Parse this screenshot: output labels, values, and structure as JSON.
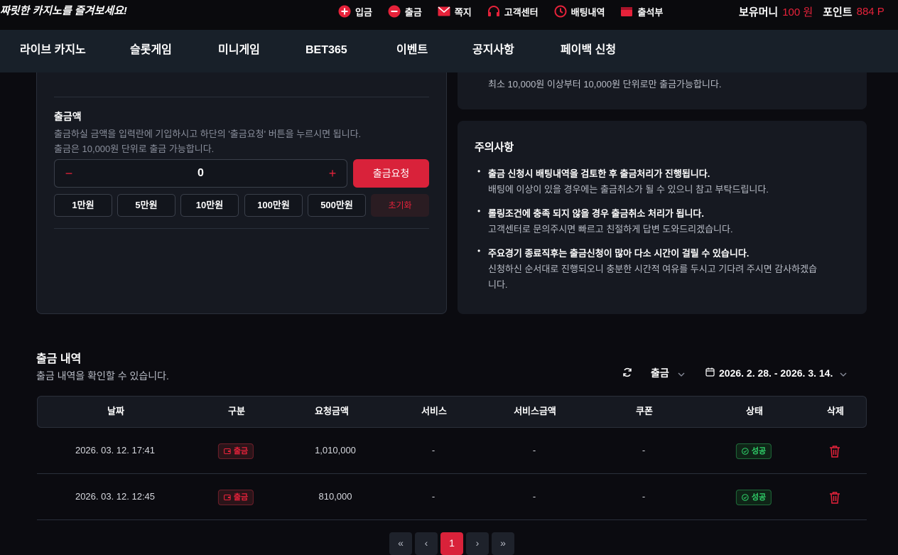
{
  "header": {
    "slogan": "짜릿한 카지노를 즐겨보세요!",
    "links": [
      {
        "label": "입금",
        "icon": "plus-circle-icon"
      },
      {
        "label": "출금",
        "icon": "minus-circle-icon"
      },
      {
        "label": "쪽지",
        "icon": "envelope-icon"
      },
      {
        "label": "고객센터",
        "icon": "headset-icon"
      },
      {
        "label": "배팅내역",
        "icon": "history-clock-icon"
      },
      {
        "label": "출석부",
        "icon": "calendar-icon"
      }
    ],
    "money_label": "보유머니",
    "money_value": "100 원",
    "point_label": "포인트",
    "point_value": "884 P"
  },
  "nav": [
    "라이브 카지노",
    "슬롯게임",
    "미니게임",
    "BET365",
    "이벤트",
    "공지사항",
    "페이백 신청"
  ],
  "withdraw": {
    "label": "출금액",
    "desc1": "출금하실 금액을 입력란에 기입하시고 하단의 '출금요청' 버튼을 누르시면 됩니다.",
    "desc2": "출금은 10,000원 단위로 출금 가능합니다.",
    "amount": "0",
    "minus": "−",
    "plus": "+",
    "submit": "출금요청",
    "quick": [
      "1만원",
      "5만원",
      "10만원",
      "100만원",
      "500만원"
    ],
    "reset": "초기화"
  },
  "info_top": "최소 10,000원 이상부터 10,000원 단위로만 출금가능합니다.",
  "notice": {
    "title": "주의사항",
    "bullet": "•",
    "items": [
      {
        "head": "출금 신청시 배팅내역을 검토한 후 출금처리가 진행됩니다.",
        "sub": "배팅에 이상이 있을 경우에는 출금취소가 될 수 있으니 참고 부탁드립니다."
      },
      {
        "head": "롤링조건에 충족 되지 않을 경우 출금취소 처리가 됩니다.",
        "sub": "고객센터로 문의주시면 빠르고 친절하게 답변 도와드리겠습니다."
      },
      {
        "head": "주요경기 종료직후는 출금신청이 많아 다소 시간이 걸릴 수 있습니다.",
        "sub": "신청하신 순서대로 진행되오니 충분한 시간적 여유를 두시고 기다려 주시면 감사하겠습",
        "sub2": "니다."
      }
    ]
  },
  "history": {
    "title": "출금 내역",
    "desc": "출금 내역을 확인할 수 있습니다.",
    "filter_type": "출금",
    "date_range": "2026. 2. 28. - 2026. 3. 14.",
    "columns": [
      "날짜",
      "구분",
      "요청금액",
      "서비스",
      "서비스금액",
      "쿠폰",
      "상태",
      "삭제"
    ],
    "rows": [
      {
        "date": "2026. 03. 12. 17:41",
        "type": "출금",
        "amount": "1,010,000",
        "service": "-",
        "service_amount": "-",
        "coupon": "-",
        "status": "성공"
      },
      {
        "date": "2026. 03. 12. 12:45",
        "type": "출금",
        "amount": "810,000",
        "service": "-",
        "service_amount": "-",
        "coupon": "-",
        "status": "성공"
      }
    ]
  },
  "pager": {
    "first": "«",
    "prev": "‹",
    "current": "1",
    "next": "›",
    "last": "»"
  },
  "colors": {
    "accent": "#d9223a",
    "success": "#2fd26a",
    "panel": "#161921",
    "nav": "#182029"
  }
}
